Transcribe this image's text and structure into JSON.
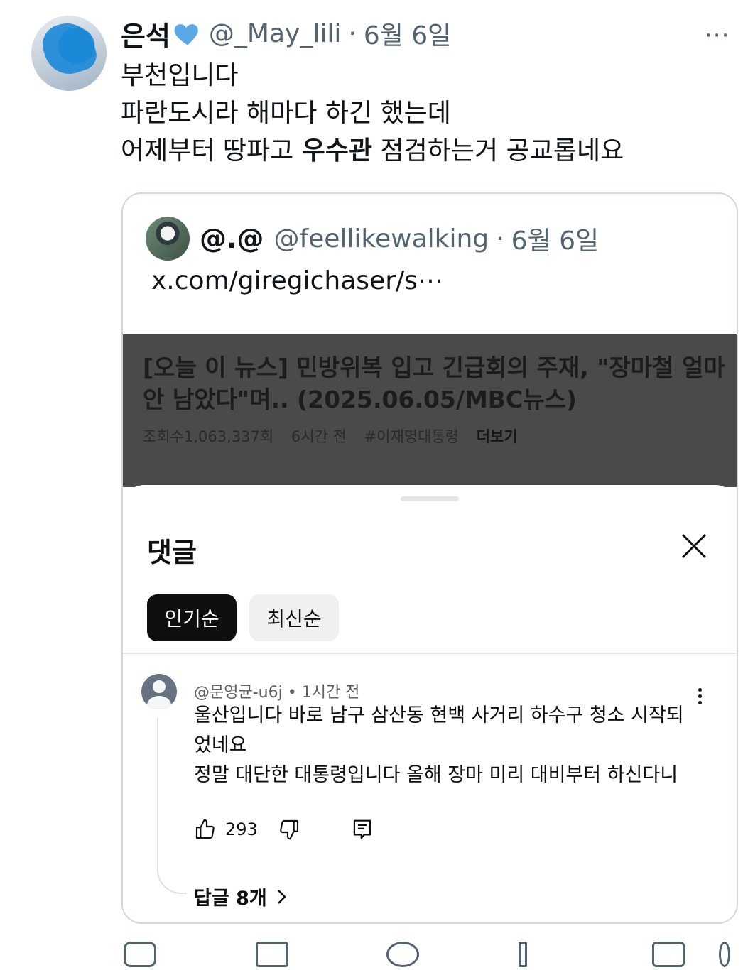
{
  "tweet": {
    "display_name": "은석",
    "handle": "@_May_lili",
    "separator": "·",
    "date": "6월 6일",
    "more_label": "···",
    "text_lines": [
      "부천입니다",
      "파란도시라 해마다 하긴 했는데"
    ],
    "line3_before": "어제부터 땅파고 ",
    "line3_bold": "우수관",
    "line3_after": " 점검하는거 공교롭네요",
    "heart_color": "#5aa9e6"
  },
  "quote": {
    "display_name": "@.@",
    "handle": "@feellikewalking",
    "separator": "·",
    "date": "6월 6일",
    "link_text": "x.com/giregichaser/s⋯"
  },
  "video": {
    "title": "[오늘 이 뉴스] 민방위복 입고 긴급회의 주재, \"장마철 얼마 안 남았다\"며.. (2025.06.05/MBC뉴스)",
    "views": "조회수1,063,337회",
    "time": "6시간 전",
    "hashtag": "#이재명대통령",
    "more": "더보기"
  },
  "comments_sheet": {
    "title": "댓글",
    "tab_top": "인기순",
    "tab_new": "최신순",
    "comment": {
      "author": "@문영균-u6j",
      "separator": "•",
      "time": "1시간 전",
      "lines": [
        "울산입니다 바로 남구 삼산동 현백 사거리  하수구 청소 시작되",
        "었네요",
        "정말 대단한 대통령입니다 올해 장마 미리 대비부터 하신다니"
      ],
      "like_count": "293",
      "replies_label": "답글 8개"
    }
  },
  "icons": {
    "heart": "blue-heart-icon",
    "close": "close-icon",
    "like": "thumbs-up-icon",
    "dislike": "thumbs-down-icon",
    "reply": "comment-icon",
    "menu": "kebab-icon",
    "chevron": "chevron-right-icon"
  }
}
